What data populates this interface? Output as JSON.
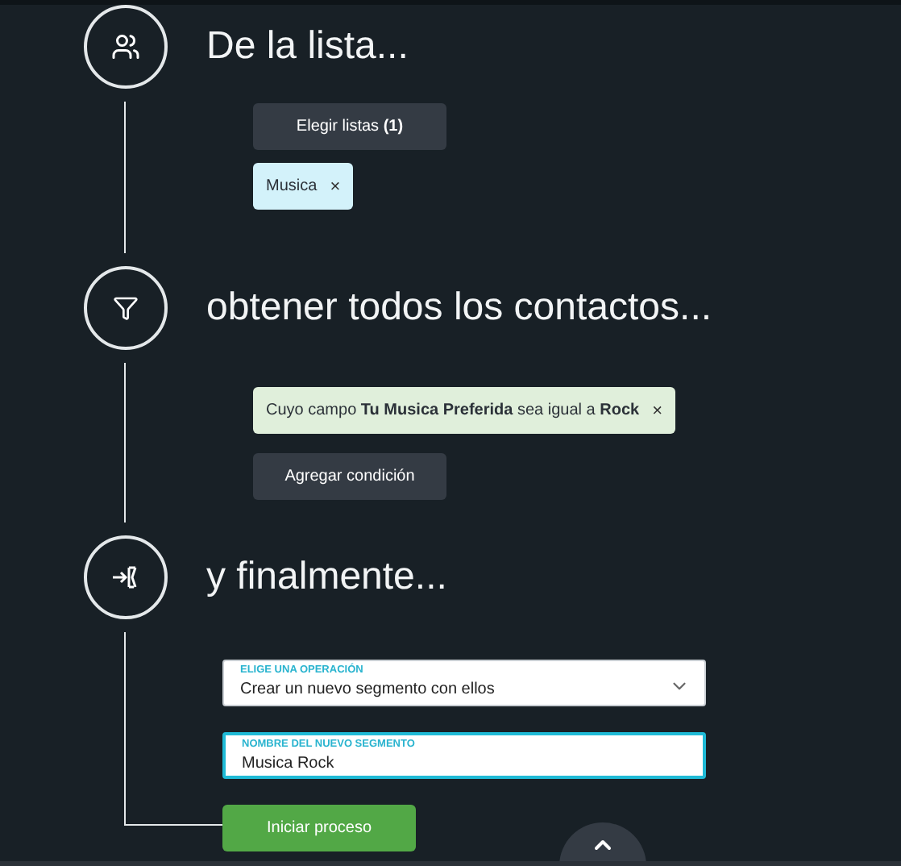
{
  "steps": [
    {
      "kind": "list",
      "title": "De la lista...",
      "button": "Elegir listas **(1)**",
      "chips": [
        {
          "label": "Musica",
          "close": "×"
        }
      ]
    },
    {
      "kind": "filter",
      "title": "obtener todos los contactos...",
      "condition": {
        "text": "Cuyo campo **Tu Musica Preferida** sea igual a **Rock**",
        "close": "×"
      },
      "button": "Agregar condición"
    },
    {
      "kind": "action",
      "title": "y finalmente...",
      "select": {
        "label": "ELIGE UNA OPERACIÓN",
        "value": "Crear un nuevo segmento con ellos"
      },
      "input": {
        "label": "NOMBRE DEL NUEVO SEGMENTO",
        "value": "Musica Rock"
      },
      "button": "Iniciar proceso"
    }
  ]
}
